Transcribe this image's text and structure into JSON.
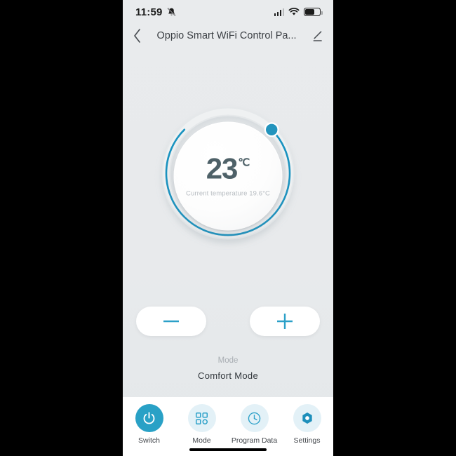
{
  "theme": {
    "accent": "#29a1c6",
    "arc_teal": "#1a93c0",
    "arc_track": "#dfe3e6",
    "background": "#e9ebed",
    "nav_bg": "#ffffff",
    "nav_circle_idle": "#e3f1f7",
    "temp_text": "#4e6168",
    "muted_text": "#a9aeb3"
  },
  "statusbar": {
    "time": "11:59",
    "notifications_icon": "bell-muted-icon",
    "signal_icon": "cellular-signal-icon",
    "signal_bars": 3,
    "wifi_icon": "wifi-icon",
    "battery_icon": "battery-icon",
    "battery_percent": 60
  },
  "navbar": {
    "back_icon": "chevron-left-icon",
    "title": "Oppio Smart WiFi Control Pa...",
    "edit_icon": "pencil-edit-icon"
  },
  "dial": {
    "set_temperature": "23",
    "unit": "℃",
    "current_temperature_text": "Current temperature 19.6°C",
    "handle_icon": "dial-handle",
    "arc_start_deg": 135,
    "arc_sweep_deg": 270,
    "arc_value_deg": 225
  },
  "steppers": {
    "minus_icon": "minus-icon",
    "minus_label": "Decrease temperature",
    "plus_icon": "plus-icon",
    "plus_label": "Increase temperature"
  },
  "mode": {
    "label": "Mode",
    "value": "Comfort  Mode"
  },
  "bottom_nav": {
    "items": [
      {
        "label": "Switch",
        "icon": "power-icon",
        "active": true
      },
      {
        "label": "Mode",
        "icon": "grid-squares-icon",
        "active": false
      },
      {
        "label": "Program Data",
        "icon": "clock-icon",
        "active": false
      },
      {
        "label": "Settings",
        "icon": "hex-gear-icon",
        "active": false
      }
    ]
  }
}
